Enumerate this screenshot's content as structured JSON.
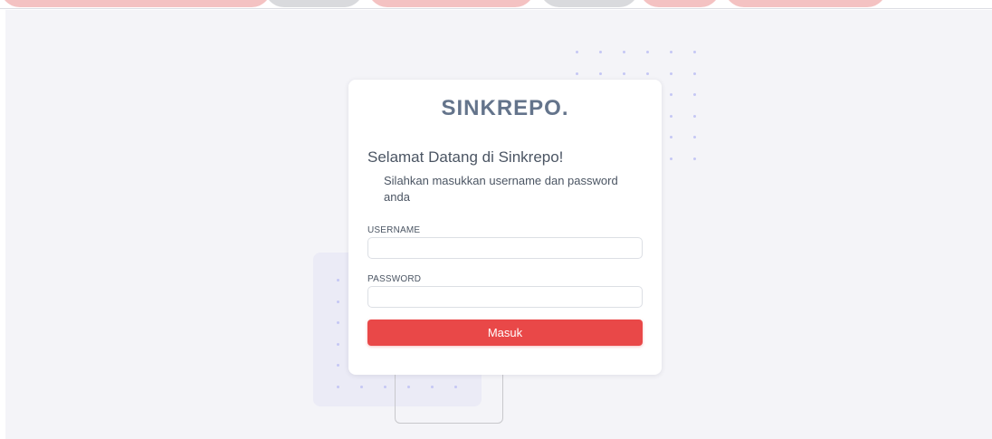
{
  "brand": {
    "name": "SINKREPO."
  },
  "login": {
    "welcome_title": "Selamat Datang di Sinkrepo!",
    "welcome_subtitle": "Silahkan masukkan username dan password anda",
    "username": {
      "label": "USERNAME",
      "value": "",
      "placeholder": ""
    },
    "password": {
      "label": "PASSWORD",
      "value": "",
      "placeholder": ""
    },
    "submit_label": "Masuk"
  },
  "colors": {
    "brand_text": "#64748b",
    "accent": "#e94848",
    "background": "#f4f4f8",
    "dot": "#c5c7f4"
  }
}
